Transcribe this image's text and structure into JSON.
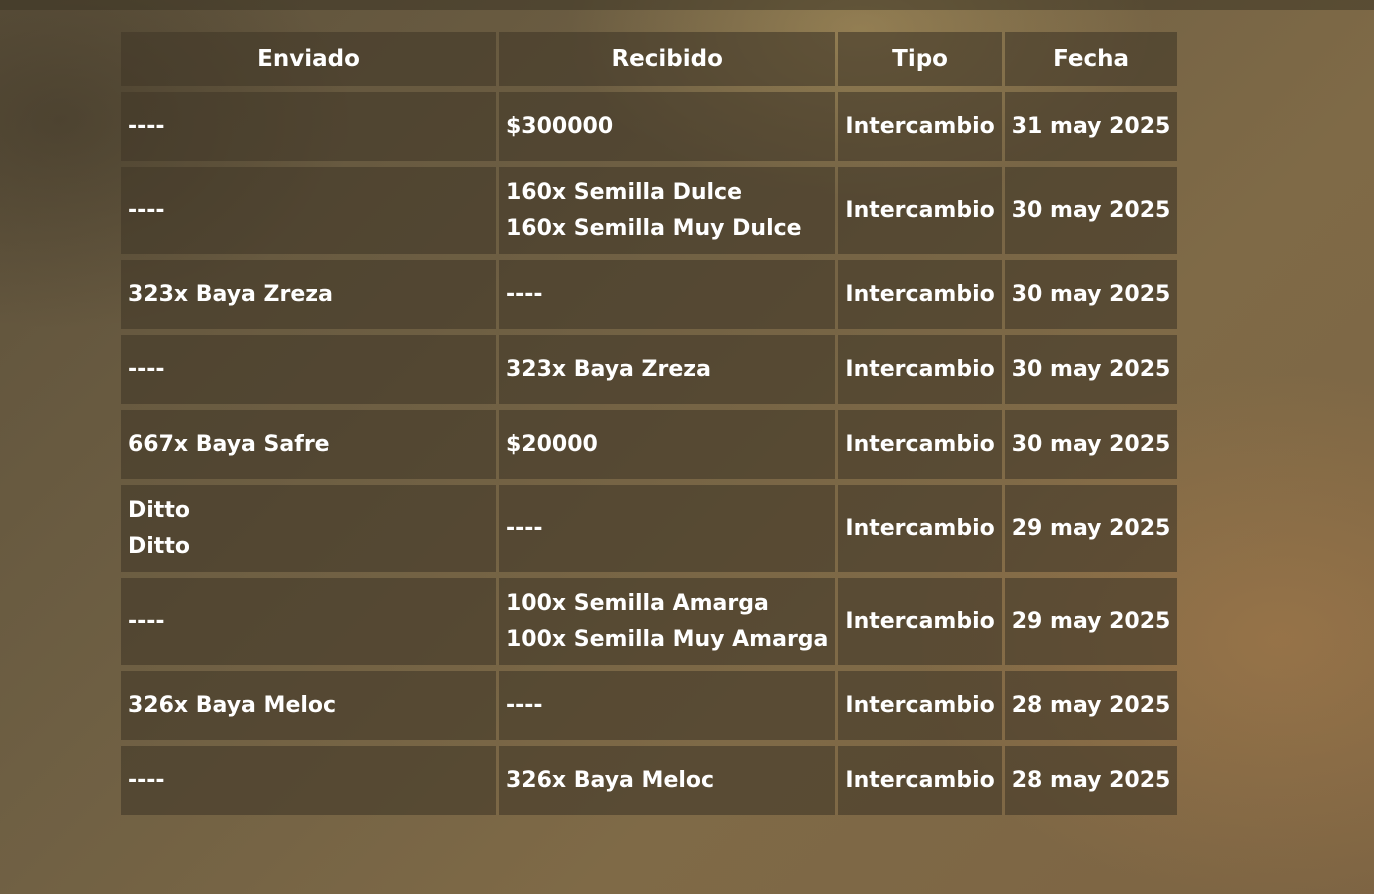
{
  "table": {
    "headers": {
      "sent": "Enviado",
      "received": "Recibido",
      "type": "Tipo",
      "date": "Fecha"
    },
    "rows": [
      {
        "sent": [
          "----"
        ],
        "received": [
          "$300000"
        ],
        "type": "Intercambio",
        "date": "31 may 2025"
      },
      {
        "sent": [
          "----"
        ],
        "received": [
          "160x Semilla Dulce",
          "160x Semilla Muy Dulce"
        ],
        "type": "Intercambio",
        "date": "30 may 2025"
      },
      {
        "sent": [
          "323x Baya Zreza"
        ],
        "received": [
          "----"
        ],
        "type": "Intercambio",
        "date": "30 may 2025"
      },
      {
        "sent": [
          "----"
        ],
        "received": [
          "323x Baya Zreza"
        ],
        "type": "Intercambio",
        "date": "30 may 2025"
      },
      {
        "sent": [
          "667x Baya Safre"
        ],
        "received": [
          "$20000"
        ],
        "type": "Intercambio",
        "date": "30 may 2025"
      },
      {
        "sent": [
          "Ditto",
          "Ditto"
        ],
        "received": [
          "----"
        ],
        "type": "Intercambio",
        "date": "29 may 2025"
      },
      {
        "sent": [
          "----"
        ],
        "received": [
          "100x Semilla Amarga",
          "100x Semilla Muy Amarga"
        ],
        "type": "Intercambio",
        "date": "29 may 2025"
      },
      {
        "sent": [
          "326x Baya Meloc"
        ],
        "received": [
          "----"
        ],
        "type": "Intercambio",
        "date": "28 may 2025"
      },
      {
        "sent": [
          "----"
        ],
        "received": [
          "326x Baya Meloc"
        ],
        "type": "Intercambio",
        "date": "28 may 2025"
      }
    ]
  }
}
